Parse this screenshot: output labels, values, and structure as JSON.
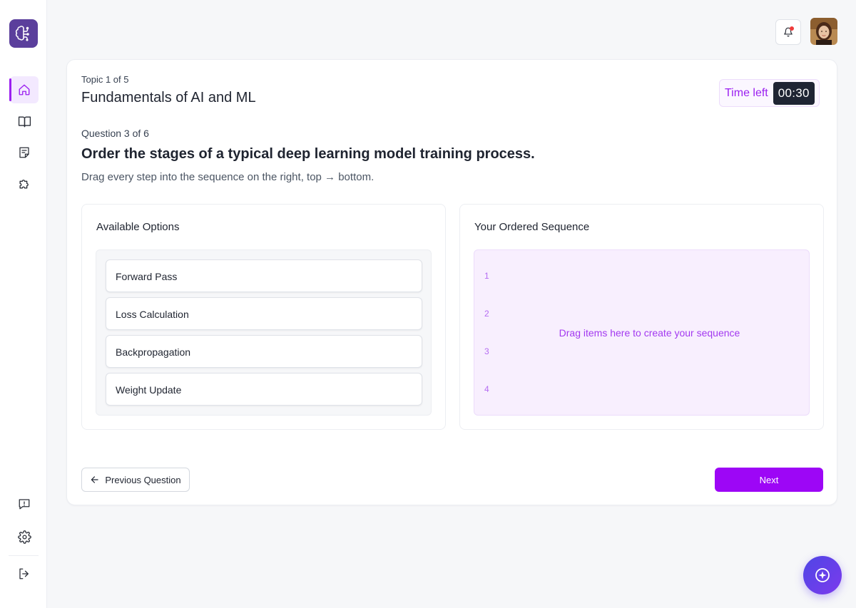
{
  "topic": {
    "label": "Topic 1 of 5",
    "title": "Fundamentals of AI and ML"
  },
  "timer": {
    "label": "Time left",
    "value": "00:30"
  },
  "question": {
    "label": "Question 3 of 6",
    "title": "Order the stages of a typical deep learning model training process.",
    "instruction": "Drag every step into the sequence on the right, top → bottom."
  },
  "available": {
    "title": "Available Options",
    "items": [
      "Forward Pass",
      "Loss Calculation",
      "Backpropagation",
      "Weight Update"
    ]
  },
  "sequence": {
    "title": "Your Ordered Sequence",
    "slots": [
      "1",
      "2",
      "3",
      "4"
    ],
    "hint": "Drag items here to create your sequence"
  },
  "nav": {
    "previous_label": "Previous Question",
    "next_label": "Next"
  },
  "sidebar": {
    "items": [
      {
        "icon": "home-icon",
        "active": true
      },
      {
        "icon": "book-icon",
        "active": false
      },
      {
        "icon": "notes-icon",
        "active": false
      },
      {
        "icon": "puzzle-icon",
        "active": false
      }
    ],
    "bottom": [
      "chat-icon",
      "gear-icon",
      "logout-icon"
    ]
  },
  "colors": {
    "accent": "#9d06f6",
    "logo_bg": "#5b3f9c",
    "timer_bg": "#1f2533",
    "drop_bg": "#f8effe"
  }
}
